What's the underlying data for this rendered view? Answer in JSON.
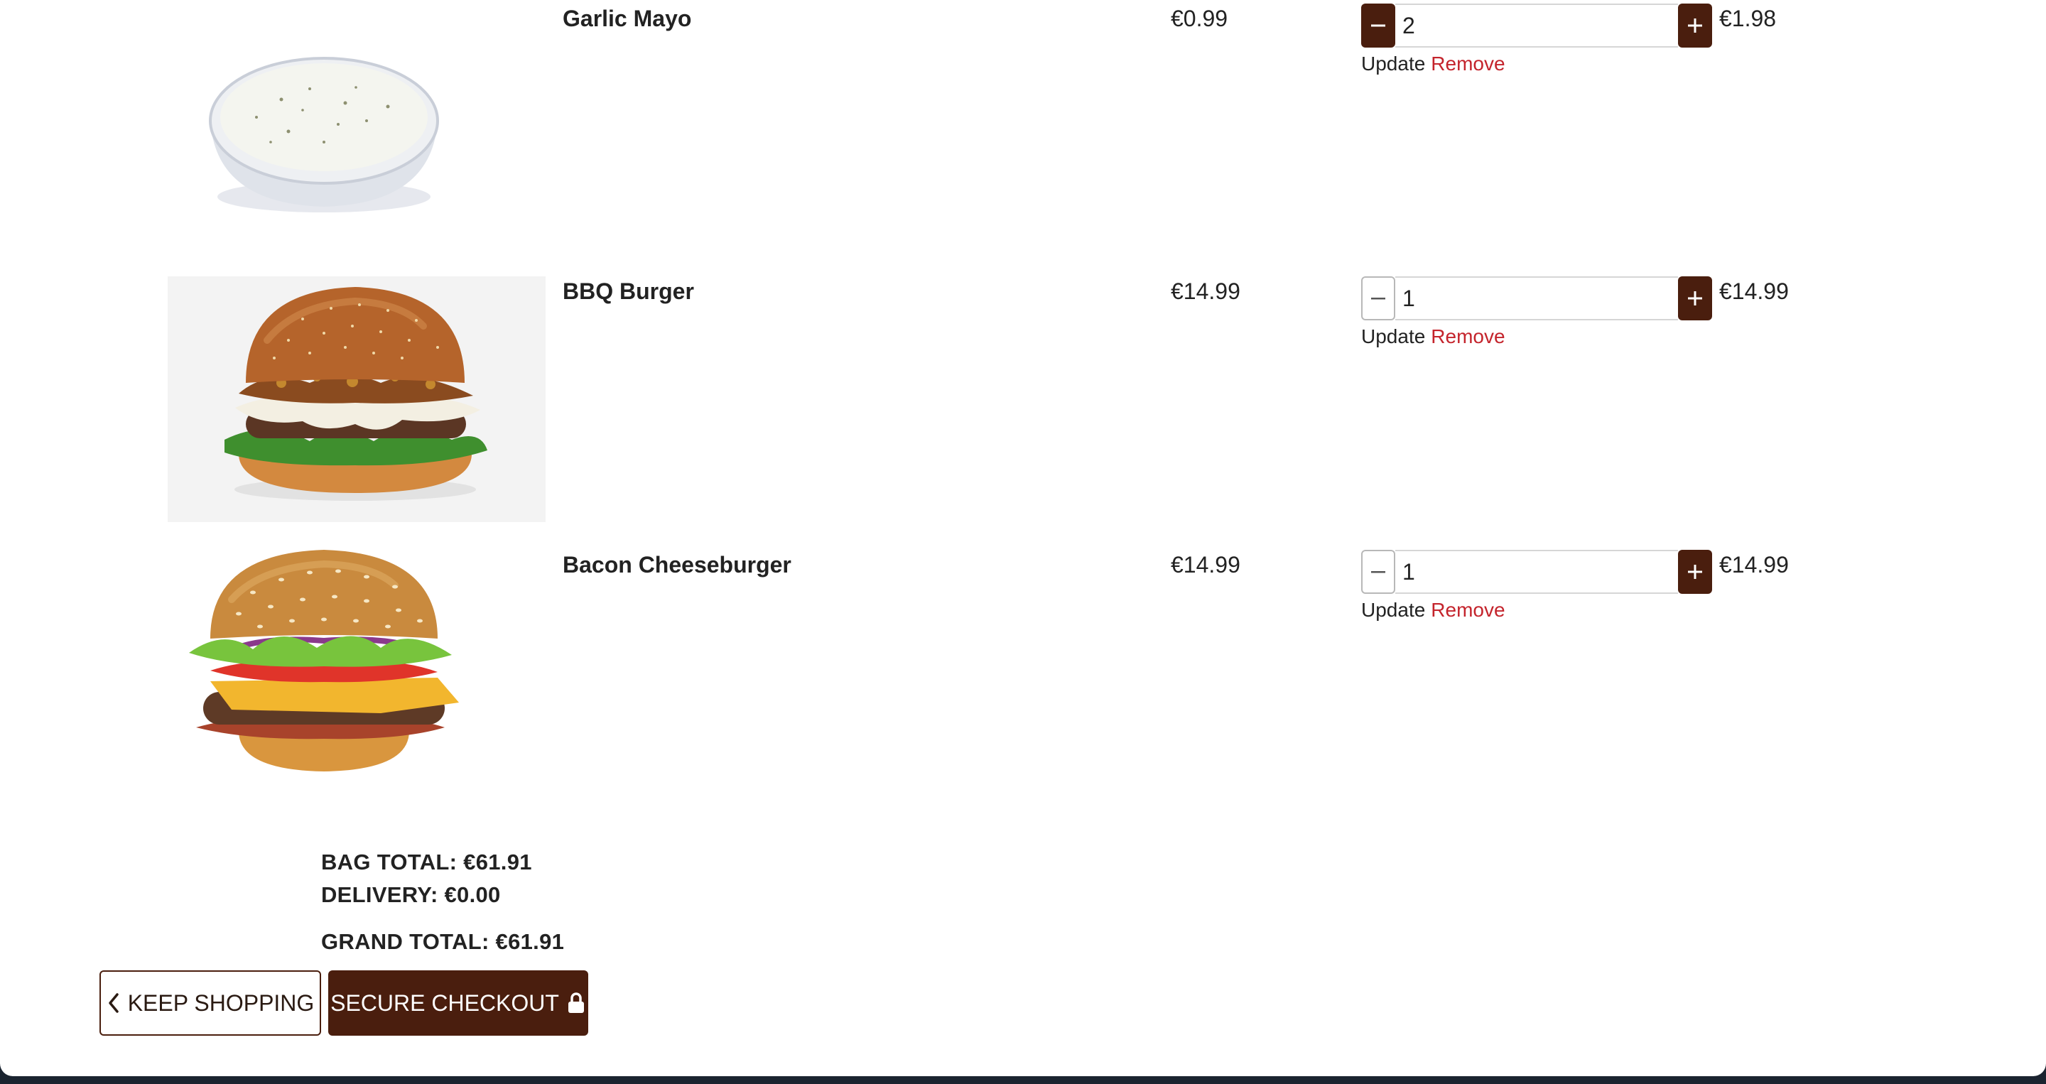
{
  "cart": {
    "items": [
      {
        "name": "Garlic Mayo",
        "price": "€0.99",
        "quantity": "2",
        "line_total": "€1.98",
        "update_label": "Update",
        "remove_label": "Remove",
        "image": "garlic-mayo-bowl"
      },
      {
        "name": "BBQ Burger",
        "price": "€14.99",
        "quantity": "1",
        "line_total": "€14.99",
        "update_label": "Update",
        "remove_label": "Remove",
        "image": "bbq-burger"
      },
      {
        "name": "Bacon Cheeseburger",
        "price": "€14.99",
        "quantity": "1",
        "line_total": "€14.99",
        "update_label": "Update",
        "remove_label": "Remove",
        "image": "bacon-cheeseburger"
      }
    ]
  },
  "summary": {
    "bag_total": "BAG TOTAL: €61.91",
    "delivery": "DELIVERY: €0.00",
    "grand_total": "GRAND TOTAL: €61.91"
  },
  "actions": {
    "keep_shopping": "KEEP SHOPPING",
    "secure_checkout": "SECURE CHECKOUT"
  },
  "colors": {
    "brand": "#4a1e0e",
    "remove": "#c4242c"
  }
}
